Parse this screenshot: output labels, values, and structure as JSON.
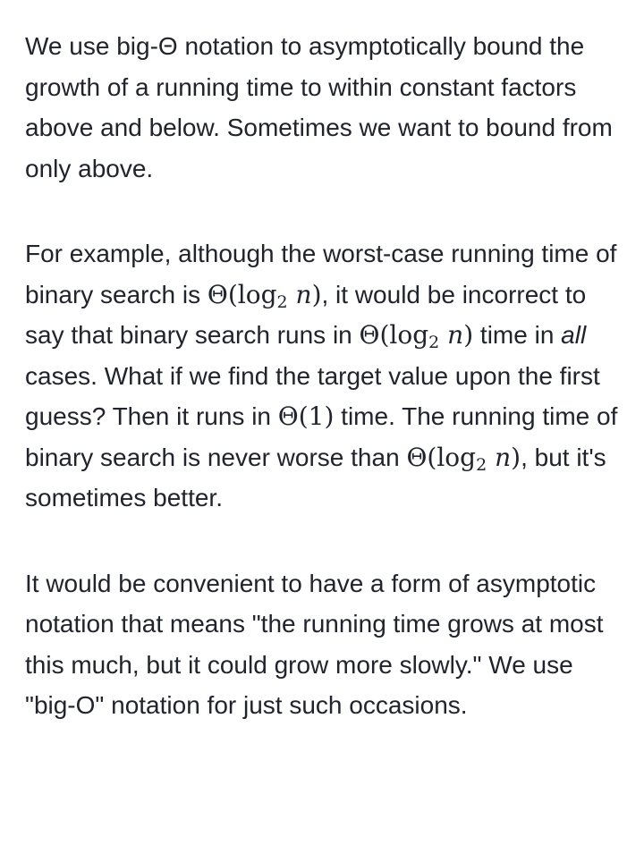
{
  "paragraphs": [
    {
      "text": "We use big-Θ notation to asymptotically bound the growth of a running time to within constant factors above and below. Sometimes we want to bound from only above."
    },
    {
      "text_1": "For example, although the worst-case running time of binary search is ",
      "math_theta": "Θ(",
      "math_log": "log",
      "math_sub": "2",
      "math_n": "n",
      "math_close": ")",
      "math_const": "Θ(1)",
      "text_2": ", it would be incorrect to say that binary search runs in ",
      "text_3": " time in ",
      "text_all": "all",
      "text_4": " cases. What if we find the target value upon the first guess? Then it runs in ",
      "text_5": " time. The running time of binary search is never worse than ",
      "text_6": ", but it's sometimes better."
    },
    {
      "text": "It would be convenient to have a form of asymptotic notation that means \"the running time grows at most this much, but it could grow more slowly.\" We use \"big-O\" notation for just such occasions."
    }
  ]
}
